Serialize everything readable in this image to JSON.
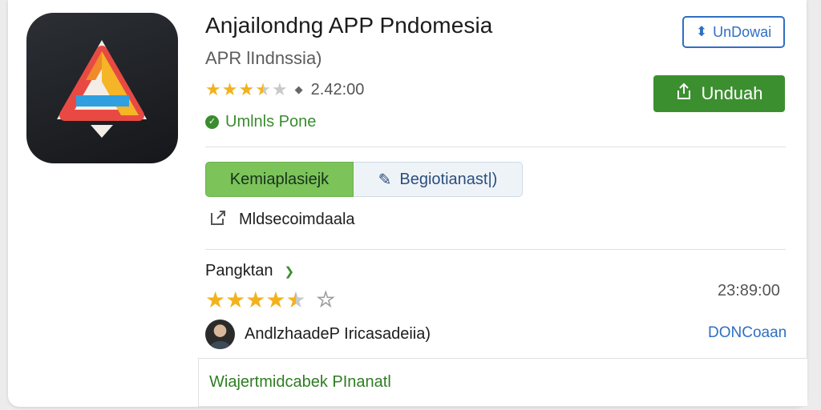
{
  "app": {
    "title": "Anjailondng APP Pndomesia",
    "subtitle": "APR lIndnssia)",
    "rating_stars": 3.5,
    "rating_count": "2.42:00",
    "status": "Umlnls Pone"
  },
  "actions": {
    "outline_label": "UnDowai",
    "primary_label": "Unduah"
  },
  "tabs": [
    {
      "label": "Kemiaplasiejk",
      "active": true
    },
    {
      "label": "Begiotianast|)",
      "active": false
    }
  ],
  "link_row": {
    "label": "Mldsecoimdaala"
  },
  "ratings_section": {
    "title": "Pangktan",
    "stars": 4.5,
    "count": "23:89:00"
  },
  "review": {
    "author": "AndlzhaadeP Iricasadeiia)",
    "link": "DONCoaan"
  },
  "footer": {
    "label": "Wiajertmidcabek PInanatl"
  },
  "icons": {
    "download": "download-icon",
    "share": "share-icon",
    "status": "check-circle-icon",
    "edit": "pencil-icon",
    "external": "external-link-icon",
    "chevron": "chevron-down-icon"
  },
  "colors": {
    "accent_green": "#3c8f2f",
    "tab_green": "#7cc35a",
    "link_blue": "#2f6fc4",
    "star": "#f2b21d"
  }
}
